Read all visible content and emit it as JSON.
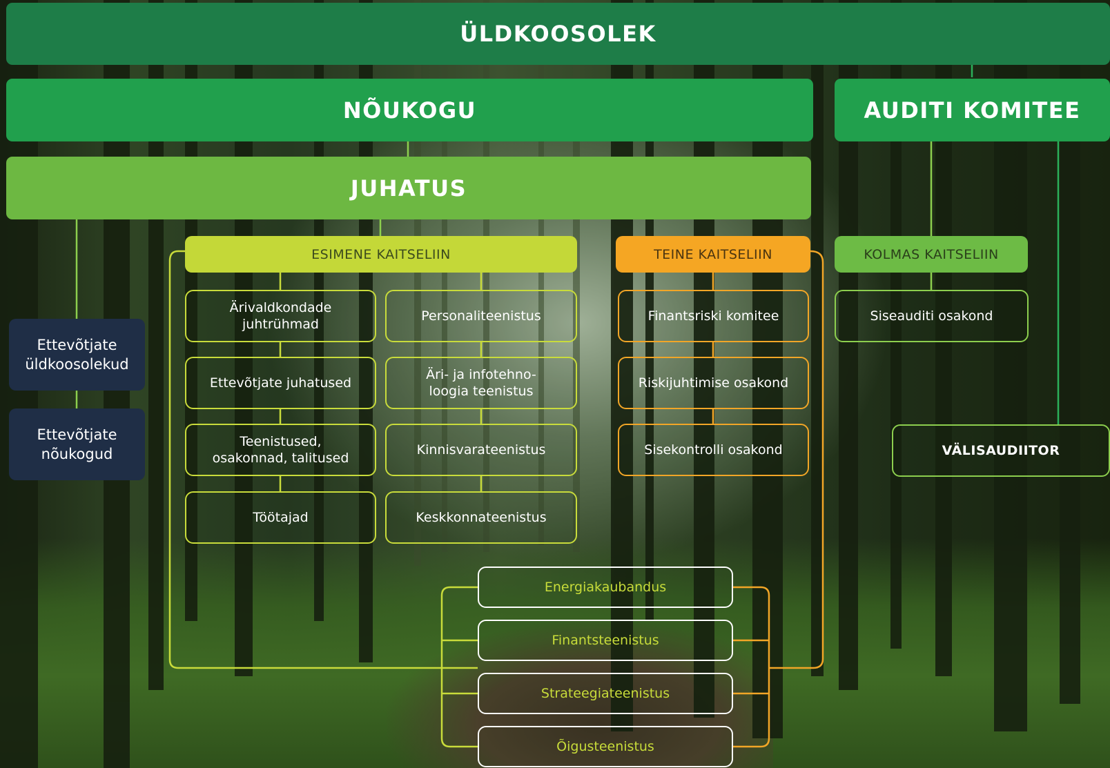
{
  "levels": {
    "general_meeting": "ÜLDKOOSOLEK",
    "supervisory_board": "NÕUKOGU",
    "audit_committee": "AUDITI KOMITEE",
    "management_board": "JUHATUS"
  },
  "lines_of_defence": {
    "first": {
      "title": "ESIMENE KAITSELIIN",
      "left_column": [
        "Ärivaldkondade\njuhtrühmad",
        "Ettevõtjate juhatused",
        "Teenistused,\nosakonnad, talitused",
        "Töötajad"
      ],
      "right_column": [
        "Personaliteenistus",
        "Äri- ja infotehno-\nloogia teenistus",
        "Kinnisvarateenistus",
        "Keskkonnateenistus"
      ]
    },
    "second": {
      "title": "TEINE KAITSELIIN",
      "items": [
        "Finantsriski komitee",
        "Riskijuhtimise osakond",
        "Sisekontrolli osakond"
      ]
    },
    "third": {
      "title": "KOLMAS KAITSELIIN",
      "items": [
        "Siseauditi osakond"
      ]
    }
  },
  "subsidiaries": {
    "meetings": "Ettevõtjate\nüldkoosolekud",
    "boards": "Ettevõtjate\nnõukogud"
  },
  "external_auditor": "VÄLISAUDIITOR",
  "shared_services": [
    "Energiakaubandus",
    "Finantsteenistus",
    "Strateegiateenistus",
    "Õigusteenistus"
  ],
  "colors": {
    "general_meeting": "#1e7d48",
    "supervisory_board": "#21a04d",
    "management_board": "#6db842",
    "first_line": "#c4d838",
    "second_line": "#f5a623",
    "third_line": "#6dbb45",
    "subsidiary_boxes": "#1f2e46"
  }
}
